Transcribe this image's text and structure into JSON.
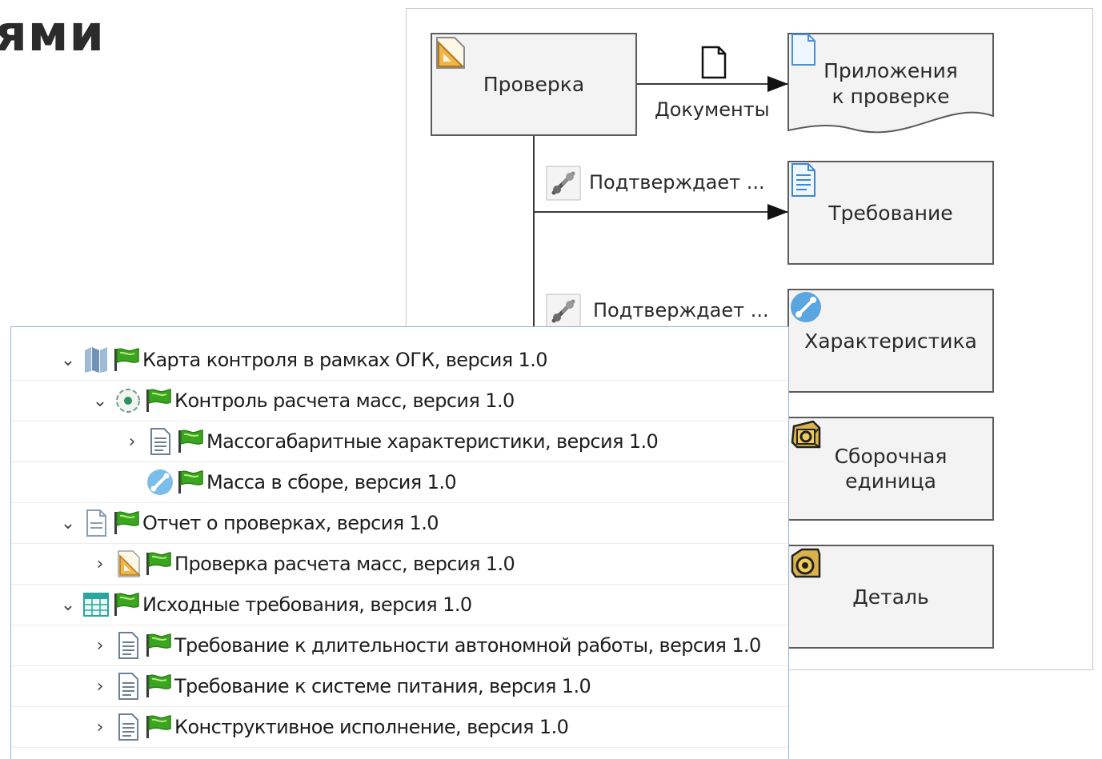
{
  "heading": {
    "text": "ями"
  },
  "diagram": {
    "nodes": {
      "check": {
        "label": "Проверка",
        "icon": "triangle-ruler-icon"
      },
      "attachments": {
        "label_line1": "Приложения",
        "label_line2": "к проверке",
        "icon": "document-icon"
      },
      "requirement": {
        "label": "Требование",
        "icon": "requirement-doc-icon"
      },
      "characteristic": {
        "label": "Характеристика",
        "icon": "characteristic-icon"
      },
      "assembly": {
        "label_line1": "Сборочная",
        "label_line2": "единица",
        "icon": "assembly-icon"
      },
      "part": {
        "label": "Деталь",
        "icon": "part-icon"
      }
    },
    "edges": {
      "documents": {
        "label": "Документы",
        "icon": "document-icon"
      },
      "confirms1": {
        "label": "Подтверждает ...",
        "icon": "link-icon"
      },
      "confirms2": {
        "label": "Подтверждает ...",
        "icon": "link-icon"
      }
    }
  },
  "tree": {
    "rows": [
      {
        "label": "Карта контроля в рамках ОГК, версия 1.0",
        "expanded": true,
        "icon": "map-icon"
      },
      {
        "label": "Контроль расчета масс, версия 1.0",
        "expanded": true,
        "icon": "target-icon"
      },
      {
        "label": "Массогабаритные характеристики, версия 1.0",
        "expanded": false,
        "icon": "requirement-doc-icon"
      },
      {
        "label": "Масса в сборе, версия 1.0",
        "expanded": null,
        "icon": "characteristic-icon"
      },
      {
        "label": "Отчет о проверках, версия 1.0",
        "expanded": true,
        "icon": "document-icon"
      },
      {
        "label": "Проверка расчета масс, версия 1.0",
        "expanded": false,
        "icon": "triangle-ruler-icon"
      },
      {
        "label": "Исходные требования, версия 1.0",
        "expanded": true,
        "icon": "table-icon"
      },
      {
        "label": "Требование к длительности автономной работы, версия 1.0",
        "expanded": false,
        "icon": "requirement-doc-icon"
      },
      {
        "label": "Требование к системе питания, версия 1.0",
        "expanded": false,
        "icon": "requirement-doc-icon"
      },
      {
        "label": "Конструктивное исполнение, версия 1.0",
        "expanded": false,
        "icon": "requirement-doc-icon"
      }
    ]
  },
  "colors": {
    "flag": "#3aa61f",
    "accent_blue": "#5aa6e0",
    "ruler": "#f0b54a",
    "border_tree": "#8fb3d9"
  }
}
